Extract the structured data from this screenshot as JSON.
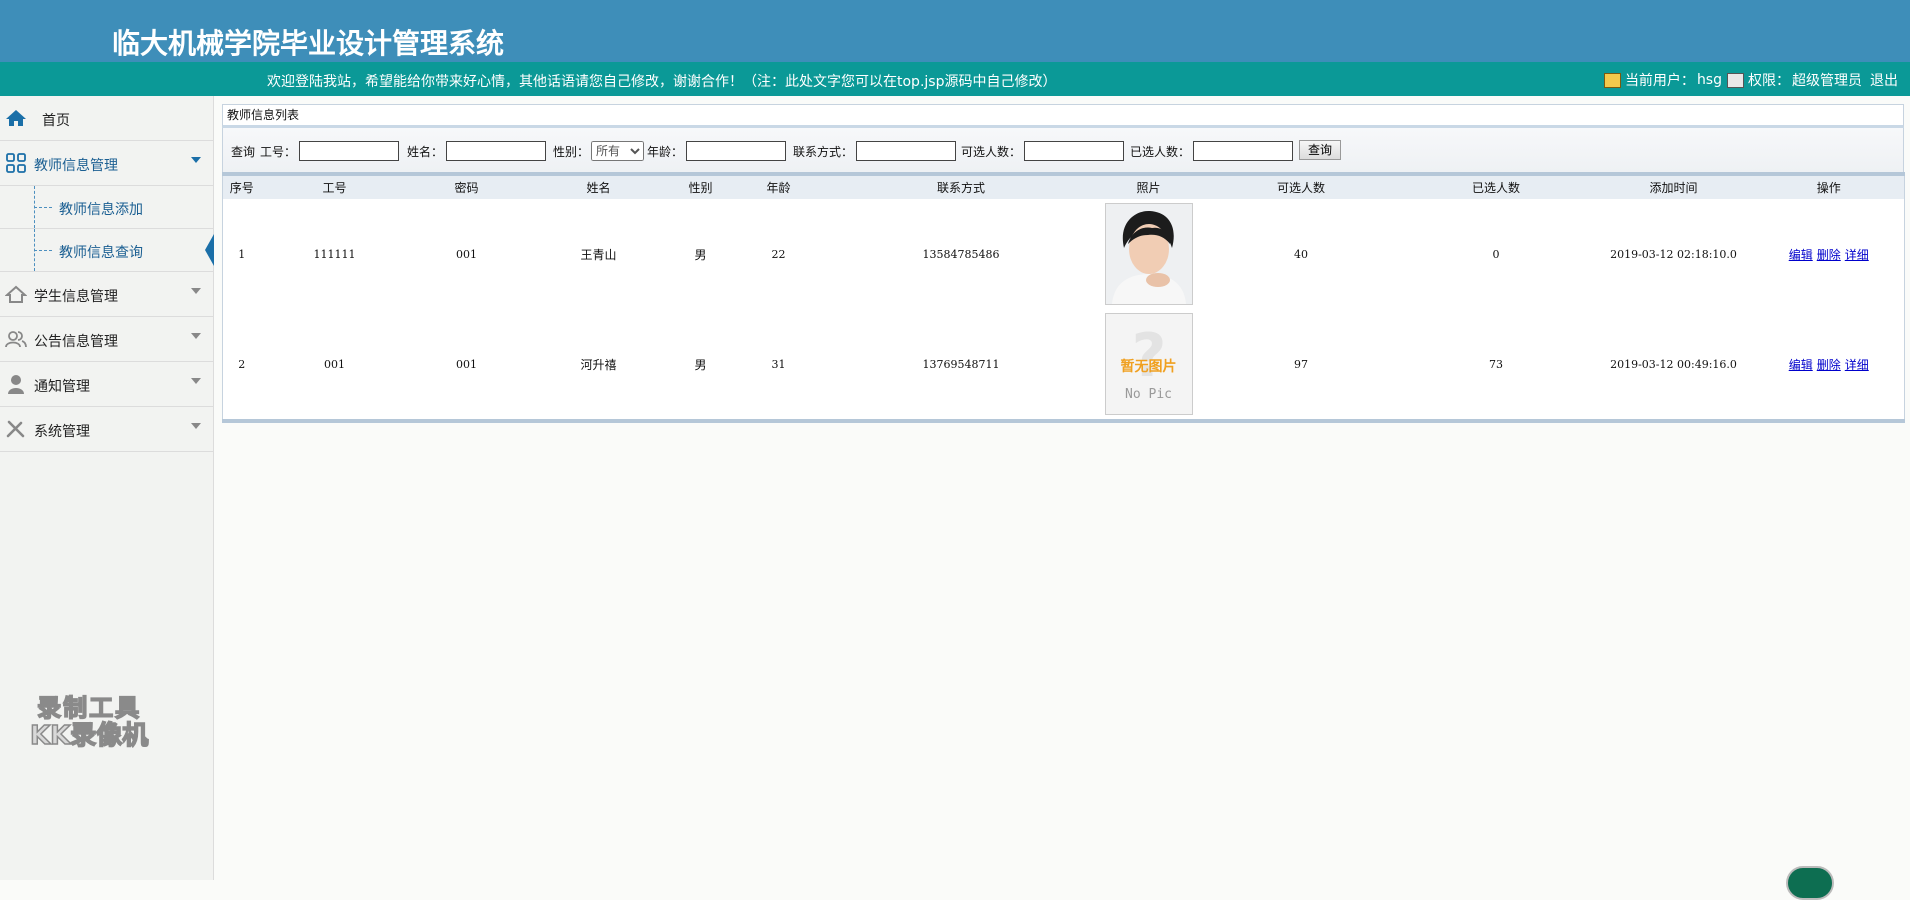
{
  "header": {
    "title": "临大机械学院毕业设计管理系统",
    "welcome": "欢迎登陆我站，希望能给你带来好心情，其他话语请您自己修改，谢谢合作！（注：此处文字您可以在top.jsp源码中自己修改）",
    "current_user_label": "当前用户：",
    "current_user": "hsg",
    "role_label": "权限：",
    "role": "超级管理员",
    "logout": "退出"
  },
  "sidebar": {
    "items": [
      {
        "label": "首页",
        "icon": "home-icon"
      },
      {
        "label": "教师信息管理",
        "icon": "grid-icon",
        "expanded": true,
        "children": [
          {
            "label": "教师信息添加"
          },
          {
            "label": "教师信息查询",
            "selected": true
          }
        ]
      },
      {
        "label": "学生信息管理",
        "icon": "house-icon"
      },
      {
        "label": "公告信息管理",
        "icon": "users-icon"
      },
      {
        "label": "通知管理",
        "icon": "person-icon"
      },
      {
        "label": "系统管理",
        "icon": "wrench-icon"
      }
    ]
  },
  "watermark": {
    "line1": "录制工具",
    "line2": "KK录像机"
  },
  "panel": {
    "title": "教师信息列表",
    "search": {
      "query_label": "查询",
      "fields": [
        {
          "label": "工号：",
          "value": ""
        },
        {
          "label": "姓名：",
          "value": ""
        },
        {
          "label": "性别：",
          "value": "所有"
        },
        {
          "label": "年龄：",
          "value": ""
        },
        {
          "label": "联系方式：",
          "value": ""
        },
        {
          "label": "可选人数：",
          "value": ""
        },
        {
          "label": "已选人数：",
          "value": ""
        }
      ],
      "button": "查询"
    },
    "table": {
      "columns": [
        "序号",
        "工号",
        "密码",
        "姓名",
        "性别",
        "年龄",
        "联系方式",
        "照片",
        "可选人数",
        "已选人数",
        "添加时间",
        "操作"
      ],
      "rows": [
        {
          "seq": "1",
          "id": "111111",
          "password": "001",
          "name": "王青山",
          "gender": "男",
          "age": "22",
          "phone": "13584785486",
          "photo": "portrait",
          "selectable": "40",
          "selected": "0",
          "time": "2019-03-12 02:18:10.0"
        },
        {
          "seq": "2",
          "id": "001",
          "password": "001",
          "name": "河升禧",
          "gender": "男",
          "age": "31",
          "phone": "13769548711",
          "photo": "no-pic",
          "selectable": "97",
          "selected": "73",
          "time": "2019-03-12 00:49:16.0"
        }
      ],
      "actions": {
        "edit": "编辑",
        "delete": "删除",
        "detail": "详细"
      },
      "no_pic_text": "暂无图片",
      "no_pic_en": "No Pic"
    }
  },
  "colors": {
    "header": "#3e8eb9",
    "subbar": "#0b9997",
    "accent": "#1b6fa8"
  }
}
